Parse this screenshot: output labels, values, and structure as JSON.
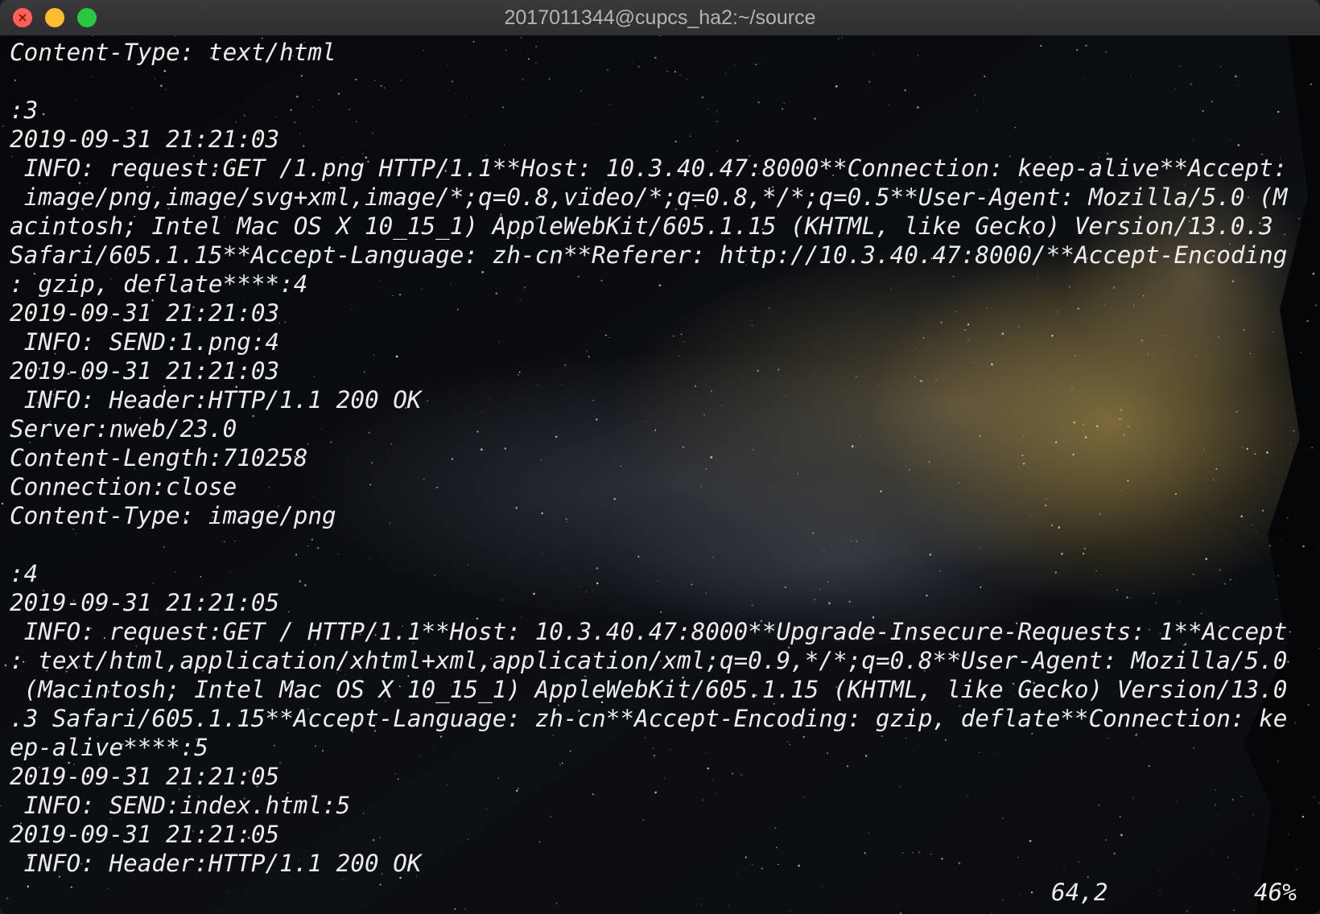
{
  "window": {
    "title": "2017011344@cupcs_ha2:~/source",
    "traffic_lights": {
      "close_color": "#fe5f57",
      "minimize_color": "#febc2e",
      "zoom_color": "#28c840"
    }
  },
  "terminal": {
    "lines": [
      "Content-Type: text/html",
      "",
      ":3",
      "2019-09-31 21:21:03",
      " INFO: request:GET /1.png HTTP/1.1**Host: 10.3.40.47:8000**Connection: keep-alive**Accept:",
      " image/png,image/svg+xml,image/*;q=0.8,video/*;q=0.8,*/*;q=0.5**User-Agent: Mozilla/5.0 (M",
      "acintosh; Intel Mac OS X 10_15_1) AppleWebKit/605.1.15 (KHTML, like Gecko) Version/13.0.3",
      "Safari/605.1.15**Accept-Language: zh-cn**Referer: http://10.3.40.47:8000/**Accept-Encoding",
      ": gzip, deflate****:4",
      "2019-09-31 21:21:03",
      " INFO: SEND:1.png:4",
      "2019-09-31 21:21:03",
      " INFO: Header:HTTP/1.1 200 OK",
      "Server:nweb/23.0",
      "Content-Length:710258",
      "Connection:close",
      "Content-Type: image/png",
      "",
      ":4",
      "2019-09-31 21:21:05",
      " INFO: request:GET / HTTP/1.1**Host: 10.3.40.47:8000**Upgrade-Insecure-Requests: 1**Accept",
      ": text/html,application/xhtml+xml,application/xml;q=0.9,*/*;q=0.8**User-Agent: Mozilla/5.0",
      " (Macintosh; Intel Mac OS X 10_15_1) AppleWebKit/605.1.15 (KHTML, like Gecko) Version/13.0",
      ".3 Safari/605.1.15**Accept-Language: zh-cn**Accept-Encoding: gzip, deflate**Connection: ke",
      "ep-alive****:5",
      "2019-09-31 21:21:05",
      " INFO: SEND:index.html:5",
      "2019-09-31 21:21:05",
      " INFO: Header:HTTP/1.1 200 OK"
    ],
    "cursor_position": "64,2",
    "scroll_percent": "46%"
  },
  "colors": {
    "text": "#ececec",
    "background": "#07090e",
    "titlebar": "#333335",
    "title_text": "#b4b4b4"
  }
}
